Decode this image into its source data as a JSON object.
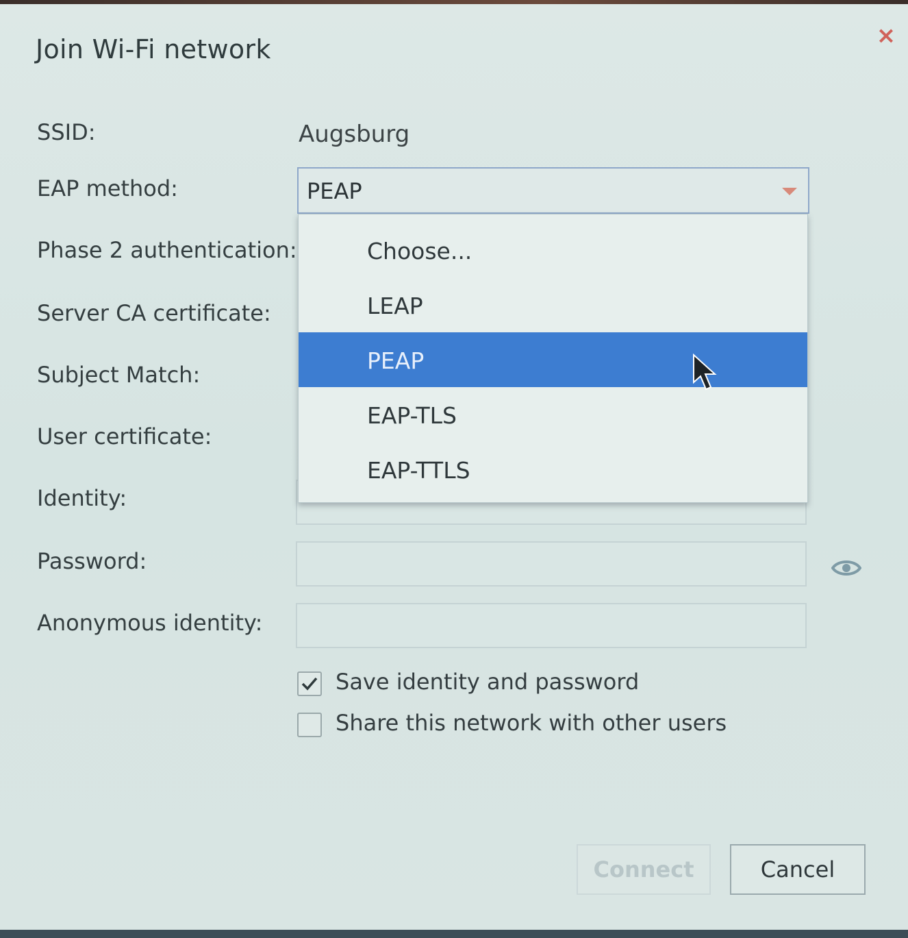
{
  "dialog": {
    "title": "Join Wi-Fi network",
    "close_glyph": "×"
  },
  "labels": {
    "ssid": "SSID:",
    "eap_method": "EAP method:",
    "phase2": "Phase 2 authentication:",
    "server_ca": "Server CA certificate:",
    "subject_match": "Subject Match:",
    "user_cert": "User certificate:",
    "identity": "Identity:",
    "password": "Password:",
    "anonymous_identity": "Anonymous identity:"
  },
  "ssid": {
    "value": "Augsburg"
  },
  "eap_method": {
    "selected": "PEAP",
    "options": [
      "Choose...",
      "LEAP",
      "PEAP",
      "EAP-TLS",
      "EAP-TTLS"
    ],
    "highlighted_index": 2
  },
  "fields": {
    "identity": "",
    "password": "",
    "anonymous_identity": ""
  },
  "checkboxes": {
    "save_identity": {
      "label": "Save identity and password",
      "checked": true
    },
    "share_network": {
      "label": "Share this network with other users",
      "checked": false
    }
  },
  "buttons": {
    "connect": "Connect",
    "cancel": "Cancel"
  },
  "icons": {
    "close": "close-icon",
    "eye": "eye-icon",
    "dropdown_arrow": "chevron-down-icon",
    "check": "checkmark-icon",
    "cursor": "mouse-pointer-icon"
  },
  "colors": {
    "accent": "#3d7dd1",
    "close": "#d0625a",
    "arrow": "#d88a7a"
  }
}
